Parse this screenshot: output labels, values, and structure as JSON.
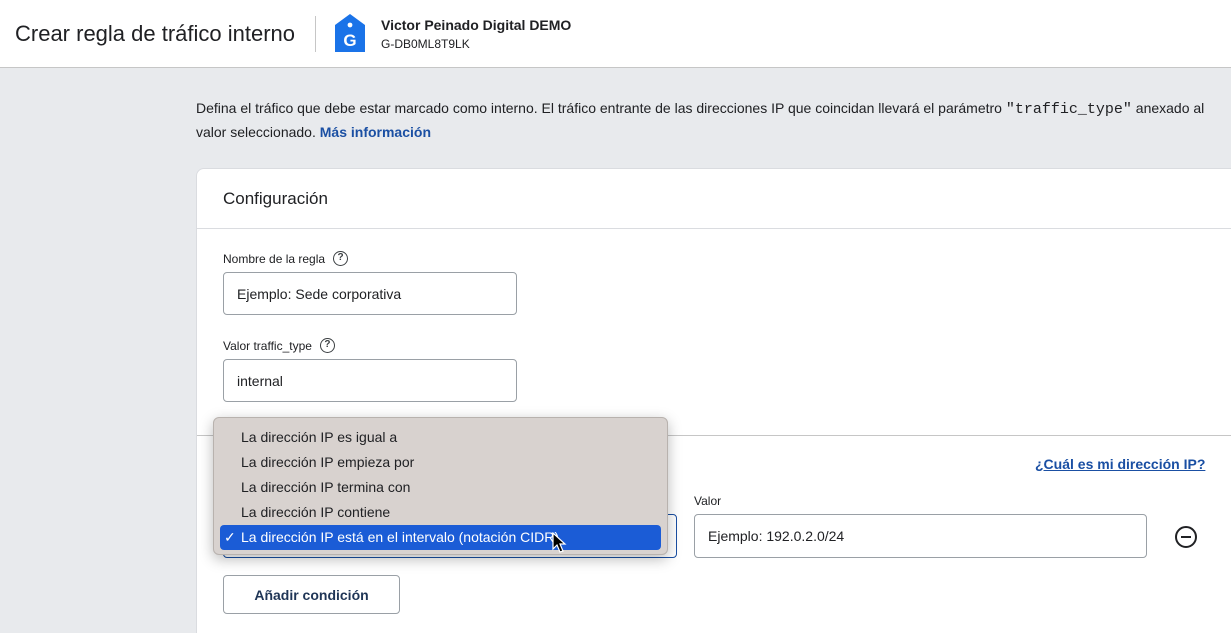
{
  "header": {
    "title": "Crear regla de tráfico interno",
    "account_name": "Victor Peinado Digital DEMO",
    "account_id": "G-DB0ML8T9LK"
  },
  "intro": {
    "text_before": "Defina el tráfico que debe estar marcado como interno. El tráfico entrante de las direcciones IP que coincidan llevará el parámetro ",
    "code": "\"traffic_type\"",
    "text_after": " anexado al valor seleccionado. ",
    "link": "Más información"
  },
  "config": {
    "title": "Configuración",
    "rule_name_label": "Nombre de la regla",
    "rule_name_value": "Ejemplo: Sede corporativa",
    "traffic_type_label": "Valor traffic_type",
    "traffic_type_value": "internal",
    "ip_link": "¿Cuál es mi dirección IP?",
    "value_label": "Valor",
    "value_placeholder": "Ejemplo: 192.0.2.0/24",
    "add_condition": "Añadir condición"
  },
  "dropdown": {
    "options": [
      "La dirección IP es igual a",
      "La dirección IP empieza por",
      "La dirección IP termina con",
      "La dirección IP contiene",
      "La dirección IP está en el intervalo (notación CIDR)"
    ],
    "selected_mark": "✓"
  },
  "colors": {
    "link": "#1a4fa3",
    "selection": "#1b5cd6",
    "ga_tag": "#1a73e8"
  },
  "icons": [
    "ga-tag-icon",
    "help-icon",
    "check-icon",
    "remove-icon",
    "cursor-icon"
  ]
}
